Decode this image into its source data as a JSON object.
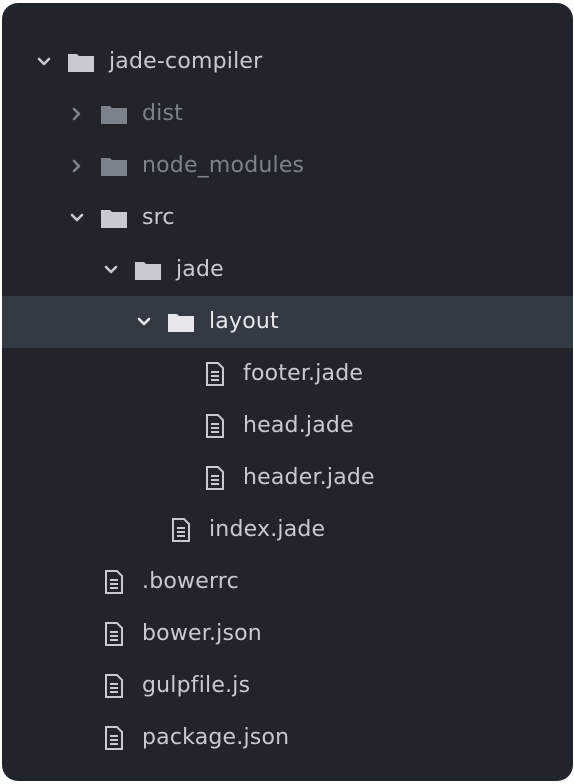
{
  "tree": [
    {
      "label": "jade-compiler",
      "type": "folder",
      "state": "expanded",
      "icon": "folder-icon"
    },
    {
      "label": "dist",
      "type": "folder",
      "state": "collapsed",
      "icon": "folder-icon",
      "muted": true
    },
    {
      "label": "node_modules",
      "type": "folder",
      "state": "collapsed",
      "icon": "folder-icon",
      "muted": true
    },
    {
      "label": "src",
      "type": "folder",
      "state": "expanded",
      "icon": "folder-icon"
    },
    {
      "label": "jade",
      "type": "folder",
      "state": "expanded",
      "icon": "folder-icon"
    },
    {
      "label": "layout",
      "type": "folder",
      "state": "expanded",
      "icon": "folder-icon",
      "selected": true
    },
    {
      "label": "footer.jade",
      "type": "file",
      "icon": "file-icon"
    },
    {
      "label": "head.jade",
      "type": "file",
      "icon": "file-icon"
    },
    {
      "label": "header.jade",
      "type": "file",
      "icon": "file-icon"
    },
    {
      "label": "index.jade",
      "type": "file",
      "icon": "file-icon"
    },
    {
      "label": ".bowerrc",
      "type": "file",
      "icon": "file-icon"
    },
    {
      "label": "bower.json",
      "type": "file",
      "icon": "file-icon"
    },
    {
      "label": "gulpfile.js",
      "type": "file",
      "icon": "file-icon"
    },
    {
      "label": "package.json",
      "type": "file",
      "icon": "file-icon"
    }
  ],
  "colors": {
    "panel_bg": "#21252b",
    "selected_bg": "#343a44",
    "text": "#c7cbd1",
    "muted_text": "#7b828c"
  }
}
